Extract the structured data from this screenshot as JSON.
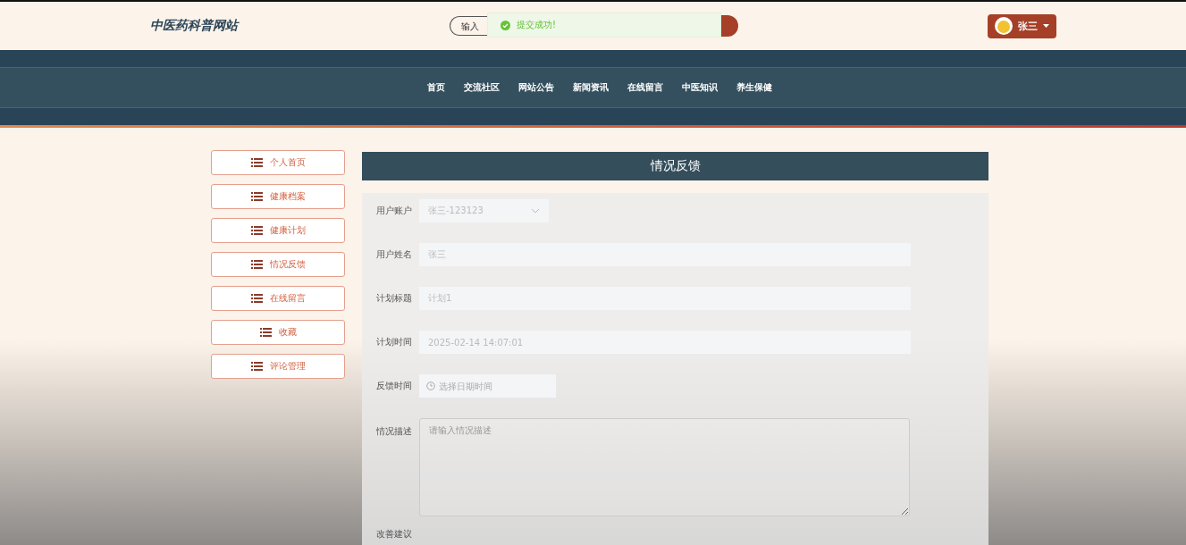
{
  "site_title": "中医药科普网站",
  "search": {
    "placeholder": "输入"
  },
  "toast": {
    "message": "提交成功!"
  },
  "user": {
    "name": "张三"
  },
  "nav": [
    {
      "label": "首页"
    },
    {
      "label": "交流社区"
    },
    {
      "label": "网站公告"
    },
    {
      "label": "新闻资讯"
    },
    {
      "label": "在线留言"
    },
    {
      "label": "中医知识"
    },
    {
      "label": "养生保健"
    }
  ],
  "sidebar": {
    "items": [
      {
        "label": "个人首页"
      },
      {
        "label": "健康档案"
      },
      {
        "label": "健康计划"
      },
      {
        "label": "情况反馈"
      },
      {
        "label": "在线留言"
      },
      {
        "label": "收藏"
      },
      {
        "label": "评论管理"
      }
    ]
  },
  "page_title": "情况反馈",
  "form": [
    {
      "kind": "select",
      "label": "用户账户",
      "value": "张三-123123"
    },
    {
      "kind": "input",
      "label": "用户姓名",
      "value": "张三"
    },
    {
      "kind": "input",
      "label": "计划标题",
      "value": "计划1"
    },
    {
      "kind": "input",
      "label": "计划时间",
      "value": "2025-02-14 14:07:01"
    },
    {
      "kind": "date",
      "label": "反馈时间",
      "placeholder": "选择日期时间"
    },
    {
      "kind": "textarea",
      "label": "情况描述",
      "placeholder": "请输入情况描述"
    },
    {
      "kind": "label",
      "label": "改善建议"
    }
  ]
}
